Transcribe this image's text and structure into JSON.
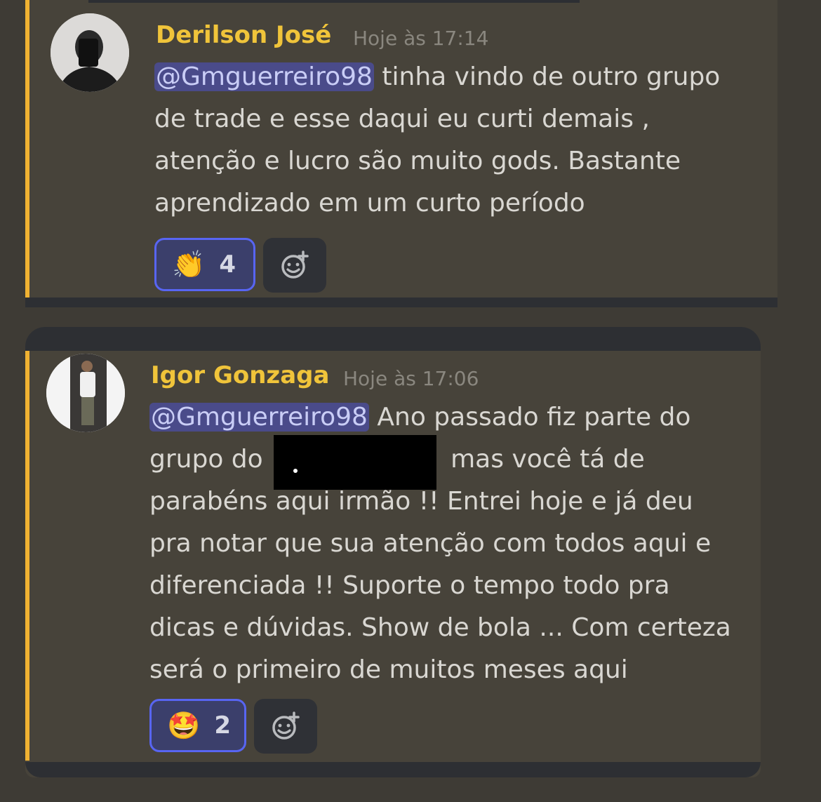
{
  "messages": [
    {
      "author": "Derilson José",
      "timestamp": "Hoje às 17:14",
      "mention": "@Gmguerreiro98",
      "text_lines": [
        " tinha vindo de outro grupo",
        "de trade e esse daqui eu curti demais ,",
        "atenção e lucro são muito gods. Bastante",
        "aprendizado em um curto período"
      ],
      "reaction": {
        "emoji": "👏",
        "count": "4"
      },
      "add_reaction_icon": "add-reaction-icon"
    },
    {
      "author": "Igor Gonzaga",
      "timestamp": "Hoje às 17:06",
      "mention": "@Gmguerreiro98",
      "text_lines": [
        " Ano passado fiz parte do",
        "grupo do ",
        "mas você tá de",
        "parabéns aqui irmão !! Entrei hoje e já deu",
        "pra notar que sua atenção com todos aqui e",
        "diferenciada !! Suporte o tempo todo pra",
        "dicas e dúvidas. Show de bola ... Com certeza",
        "será o primeiro de muitos meses aqui"
      ],
      "reaction": {
        "emoji": "🤩",
        "count": "2"
      },
      "add_reaction_icon": "add-reaction-icon"
    }
  ],
  "colors": {
    "background": "#3e3b35",
    "message_bg": "#47433a",
    "author": "#f0c43a",
    "mention_bg": "#4a4b8a",
    "reaction_border": "#5865f2",
    "highlight_bar": "#f0b232"
  }
}
